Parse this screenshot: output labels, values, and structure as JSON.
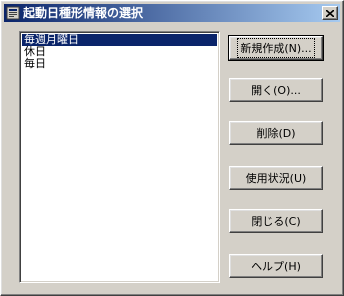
{
  "window": {
    "title": "起動日種形情報の選択",
    "close_icon": "close-icon"
  },
  "list": {
    "items": [
      "毎週月曜日",
      "休日",
      "毎日"
    ],
    "selected_index": 0
  },
  "buttons": {
    "new_label": "新規作成(N)...",
    "open_label": "開く(O)...",
    "delete_label": "削除(D)",
    "usage_label": "使用状況(U)",
    "close_label": "閉じる(C)",
    "help_label": "ヘルプ(H)"
  },
  "colors": {
    "titlebar_start": "#0a246a",
    "titlebar_end": "#a6caf0",
    "face": "#d4d0c8",
    "selection": "#0a246a"
  }
}
